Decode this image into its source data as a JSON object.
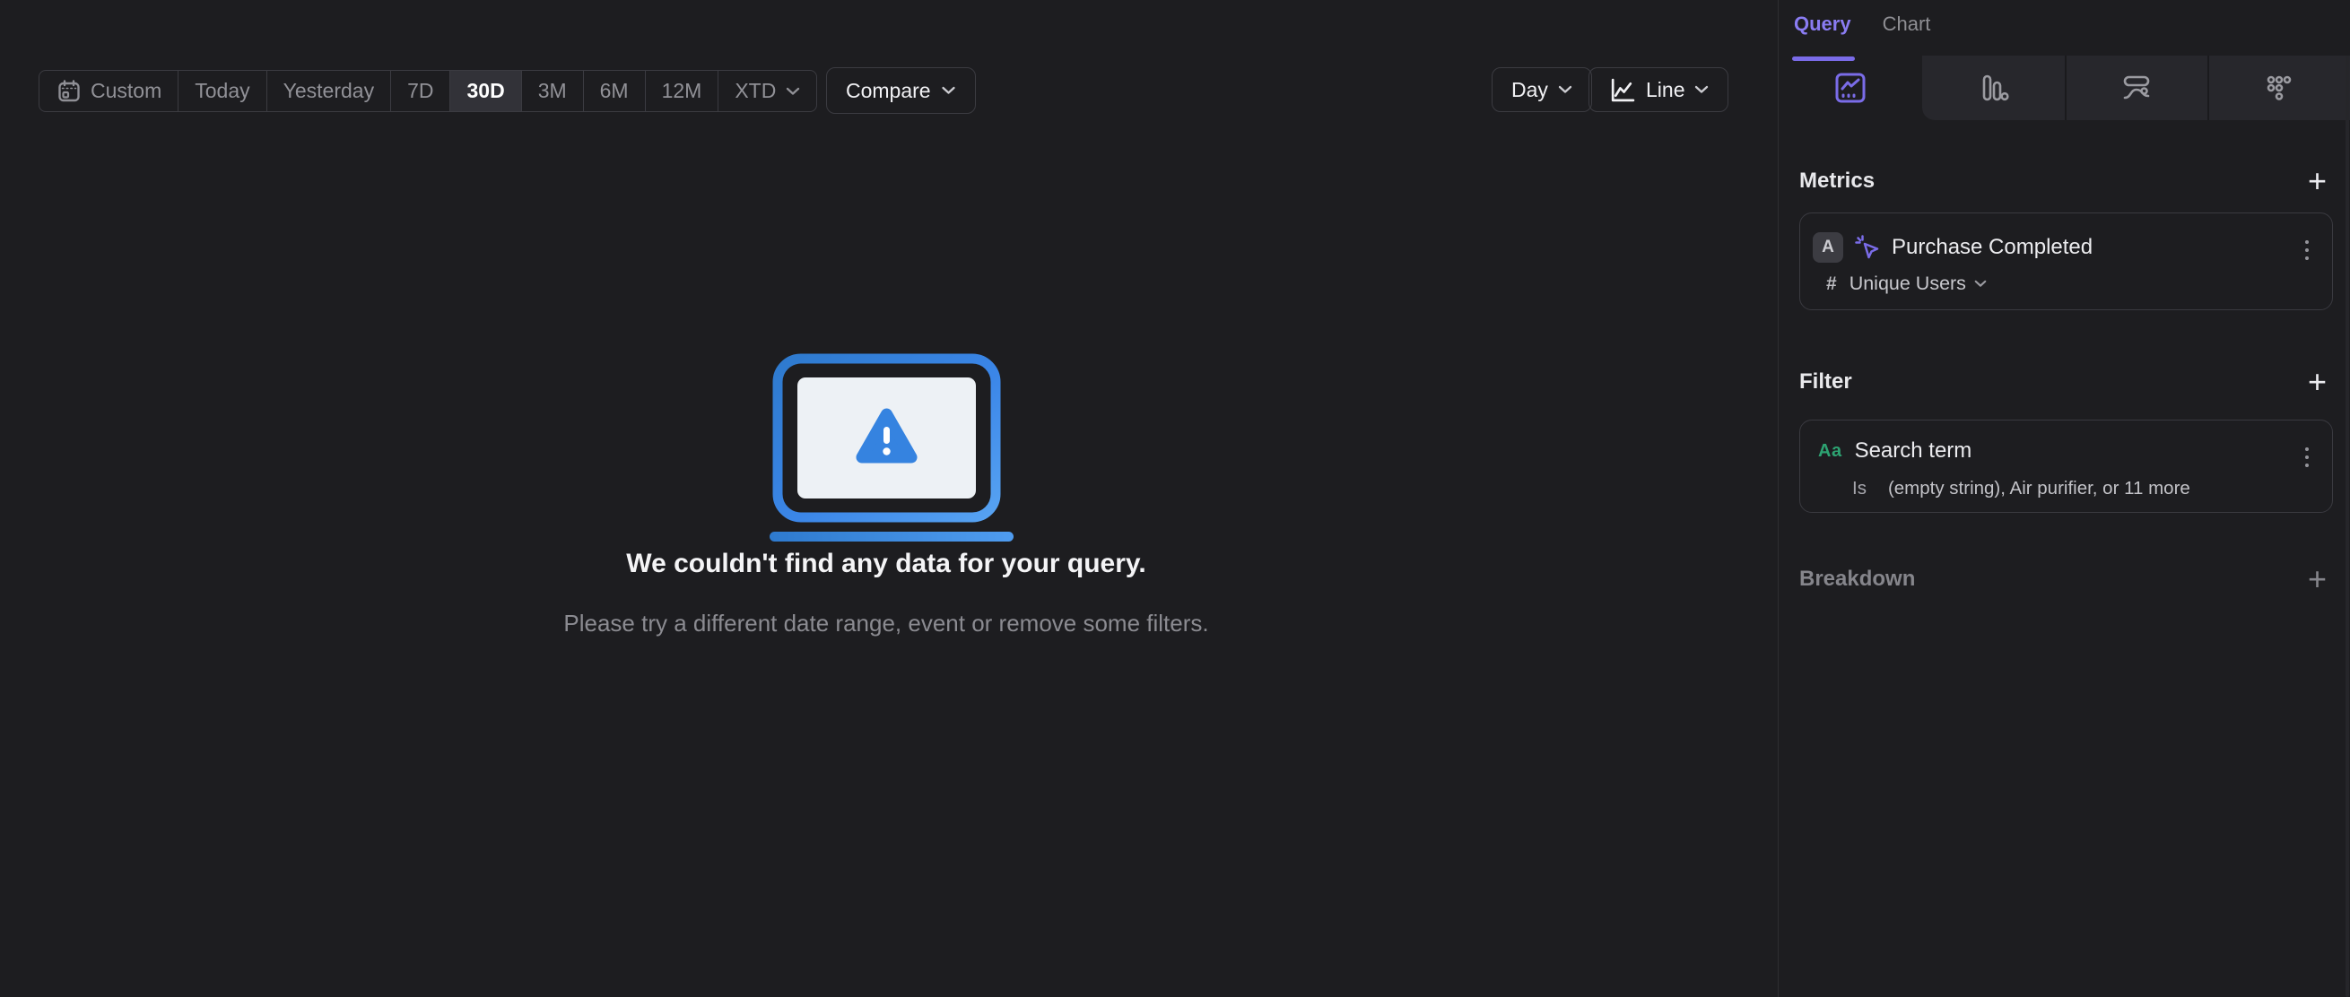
{
  "toolbar": {
    "date_ranges": [
      {
        "label": "Custom",
        "selected": false
      },
      {
        "label": "Today",
        "selected": false
      },
      {
        "label": "Yesterday",
        "selected": false
      },
      {
        "label": "7D",
        "selected": false
      },
      {
        "label": "30D",
        "selected": true
      },
      {
        "label": "3M",
        "selected": false
      },
      {
        "label": "6M",
        "selected": false
      },
      {
        "label": "12M",
        "selected": false
      },
      {
        "label": "XTD",
        "selected": false
      }
    ],
    "compare_label": "Compare",
    "granularity_label": "Day",
    "chart_style_label": "Line"
  },
  "empty_state": {
    "title": "We couldn't find any data for your query.",
    "subtitle": "Please try a different date range, event or remove some filters."
  },
  "sidebar": {
    "tabs": [
      {
        "label": "Query",
        "active": true
      },
      {
        "label": "Chart",
        "active": false
      }
    ],
    "chart_type_tabs": [
      {
        "icon": "insights-line-chart",
        "active": true
      },
      {
        "icon": "bar-chart",
        "active": false
      },
      {
        "icon": "flows",
        "active": false
      },
      {
        "icon": "retention",
        "active": false
      }
    ],
    "metrics": {
      "header": "Metrics",
      "add_label": "+",
      "items": [
        {
          "letter": "A",
          "event_icon": "event-cursor",
          "event": "Purchase Completed",
          "agg_symbol": "#",
          "aggregation": "Unique Users"
        }
      ]
    },
    "filter": {
      "header": "Filter",
      "add_label": "+",
      "items": [
        {
          "type_badge": "Aa",
          "property": "Search term",
          "operator": "Is",
          "value": "(empty string), Air purifier, or 11 more"
        }
      ]
    },
    "breakdown": {
      "header": "Breakdown",
      "add_label": "+"
    }
  },
  "colors": {
    "accent_purple": "#7a6ce8",
    "accent_green": "#2da372",
    "laptop_blue_dark": "#2e7ace",
    "laptop_blue_light": "#57a3f2",
    "warning_triangle_blue": "#3583e0"
  }
}
